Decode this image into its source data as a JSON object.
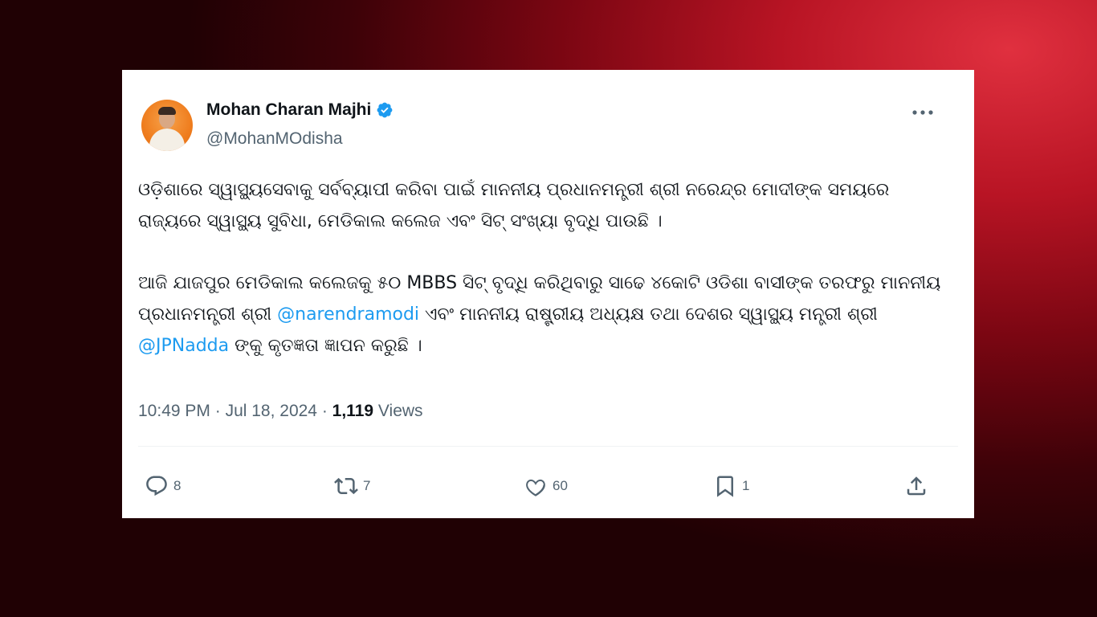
{
  "author": {
    "name": "Mohan Charan Majhi",
    "handle": "@MohanMOdisha"
  },
  "post": {
    "paragraph1": "ଓଡ଼ିଶାରେ ସ୍ୱାସ୍ଥ୍ୟସେବାକୁ ସର୍ବବ୍ୟାପୀ କରିବା ପାଇଁ ମାନନୀୟ ପ୍ରଧାନମନ୍ତ୍ରୀ ଶ୍ରୀ ନରେନ୍ଦ୍ର ମୋଦୀଙ୍କ ସମୟରେ ରାଜ୍ୟରେ ସ୍ୱାସ୍ଥ୍ୟ ସୁବିଧା, ମେଡିକାଲ କଲେଜ ଏବଂ ସିଟ୍ ସଂଖ୍ୟା ବୃଦ୍ଧି ପାଉଛି ।",
    "p2_part1": "ଆଜି ଯାଜପୁର ମେଡିକାଲ କଲେଜକୁ ୫୦ MBBS ସିଟ୍ ବୃଦ୍ଧି କରିଥିବାରୁ ସାଢେ ୪କୋଟି ଓଡିଶା ବାସୀଙ୍କ ତରଫରୁ ମାନନୀୟ ପ୍ରଧାନମନ୍ତ୍ରୀ ଶ୍ରୀ ",
    "mention1": "@narendramodi",
    "p2_part2": " ଏବଂ ମାନନୀୟ ରାଷ୍ଟ୍ରୀୟ ଅଧ୍ୟକ୍ଷ ତଥା ଦେଶର ସ୍ୱାସ୍ଥ୍ୟ ମନ୍ତ୍ରୀ ଶ୍ରୀ ",
    "mention2": "@JPNadda",
    "p2_part3": " ଙ୍କୁ କୃତଜ୍ଞତା ଜ୍ଞାପନ କରୁଛି ।"
  },
  "meta": {
    "time": "10:49 PM",
    "sep1": " · ",
    "date": "Jul 18, 2024",
    "sep2": " · ",
    "views_count": "1,119",
    "views_label": " Views"
  },
  "actions": {
    "replies": "8",
    "reposts": "7",
    "likes": "60",
    "bookmarks": "1"
  },
  "icons": [
    "verified-badge-icon",
    "more-options-icon",
    "reply-icon",
    "repost-icon",
    "like-icon",
    "bookmark-icon",
    "share-icon"
  ],
  "colors": {
    "accent": "#1d9bf0",
    "text": "#0f1419",
    "muted": "#536471"
  }
}
